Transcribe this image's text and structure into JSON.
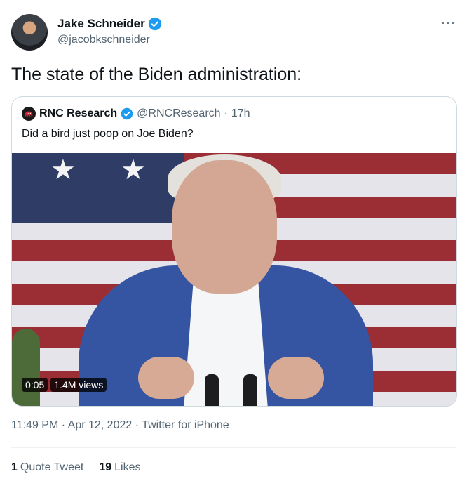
{
  "author": {
    "name": "Jake Schneider",
    "handle": "@jacobkschneider"
  },
  "more_label": "···",
  "tweet_text": "The state of the Biden administration:",
  "quoted": {
    "name": "RNC Research",
    "handle": "@RNCResearch",
    "separator": "·",
    "time": "17h",
    "text": "Did a bird just poop on Joe Biden?",
    "video_time": "0:05",
    "video_views": "1.4M views"
  },
  "meta": {
    "time": "11:49 PM",
    "separator": "·",
    "date": "Apr 12, 2022",
    "source": "Twitter for iPhone"
  },
  "stats": {
    "quote_count": "1",
    "quote_label": "Quote Tweet",
    "likes_count": "19",
    "likes_label": "Likes"
  },
  "colors": {
    "verified": "#1d9bf0",
    "secondary_text": "#536471",
    "border": "#cfd9de"
  },
  "icons": [
    "verified-badge-icon",
    "more-icon",
    "rnc-elephant-icon"
  ]
}
